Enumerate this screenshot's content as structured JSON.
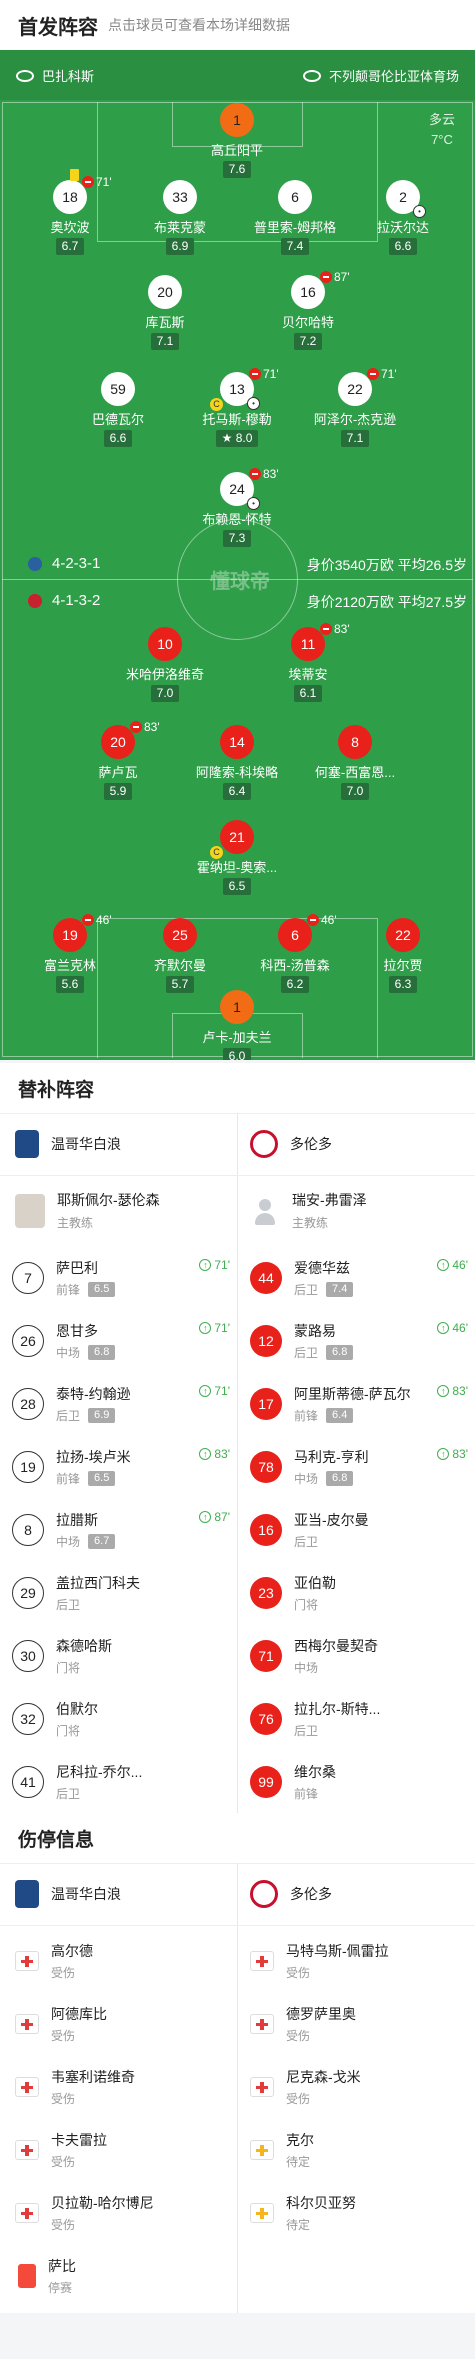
{
  "header": {
    "title": "首发阵容",
    "subtitle": "点击球员可查看本场详细数据"
  },
  "pitch": {
    "home_team": "巴扎科斯",
    "venue": "不列颠哥伦比亚体育场",
    "weather": {
      "condition": "多云",
      "temp": "7°C"
    },
    "watermark": "懂球帝",
    "home_formation": "4-2-3-1",
    "away_formation": "4-1-3-2",
    "home_value": "身价3540万欧 平均26.5岁",
    "away_value": "身价2120万欧 平均27.5岁",
    "colors": {
      "grass": "#2f9e49",
      "home_shirt": "#ffffff",
      "away_shirt": "#e8211a",
      "gk_shirt": "#f26c16"
    },
    "home_players": [
      {
        "num": "1",
        "name": "高丘阳平",
        "rating": "7.6"
      },
      {
        "num": "18",
        "name": "奥坎波",
        "rating": "6.7",
        "sub": "71'",
        "card": "yellow"
      },
      {
        "num": "33",
        "name": "布莱克蒙",
        "rating": "6.9"
      },
      {
        "num": "6",
        "name": "普里索-姆邦格",
        "rating": "7.4"
      },
      {
        "num": "2",
        "name": "拉沃尔达",
        "rating": "6.6"
      },
      {
        "num": "20",
        "name": "库瓦斯",
        "rating": "7.1"
      },
      {
        "num": "16",
        "name": "贝尔哈特",
        "rating": "7.2",
        "sub": "87'"
      },
      {
        "num": "59",
        "name": "巴德瓦尔",
        "rating": "6.6"
      },
      {
        "num": "13",
        "name": "托马斯-穆勒",
        "rating": "8.0",
        "sub": "71'",
        "star": true
      },
      {
        "num": "22",
        "name": "阿泽尔-杰克逊",
        "rating": "7.1",
        "sub": "71'"
      },
      {
        "num": "24",
        "name": "布赖恩-怀特",
        "rating": "7.3",
        "sub": "83'"
      }
    ],
    "away_players": [
      {
        "num": "10",
        "name": "米哈伊洛维奇",
        "rating": "7.0"
      },
      {
        "num": "11",
        "name": "埃蒂安",
        "rating": "6.1",
        "sub": "83'"
      },
      {
        "num": "20",
        "name": "萨卢瓦",
        "rating": "5.9",
        "sub": "83'"
      },
      {
        "num": "14",
        "name": "阿隆索-科埃略",
        "rating": "6.4"
      },
      {
        "num": "8",
        "name": "何塞-西富恩...",
        "rating": "7.0"
      },
      {
        "num": "21",
        "name": "霍纳坦-奥索...",
        "rating": "6.5"
      },
      {
        "num": "19",
        "name": "富兰克林",
        "rating": "5.6",
        "sub": "46'"
      },
      {
        "num": "25",
        "name": "齐默尔曼",
        "rating": "5.7"
      },
      {
        "num": "6",
        "name": "科西-汤普森",
        "rating": "6.2",
        "sub": "46'"
      },
      {
        "num": "22",
        "name": "拉尔贾",
        "rating": "6.3"
      },
      {
        "num": "1",
        "name": "卢卡-加夫兰",
        "rating": "6.0"
      }
    ]
  },
  "subs": {
    "title": "替补阵容",
    "home_team": "温哥华白浪",
    "away_team": "多伦多",
    "home_coach": {
      "name": "耶斯佩尔-瑟伦森",
      "role": "主教练"
    },
    "away_coach": {
      "name": "瑞安-弗雷泽",
      "role": "主教练"
    },
    "home": [
      {
        "num": "7",
        "name": "萨巴利",
        "pos": "前锋",
        "rating": "6.5",
        "in": "71'"
      },
      {
        "num": "26",
        "name": "恩甘多",
        "pos": "中场",
        "rating": "6.8",
        "in": "71'"
      },
      {
        "num": "28",
        "name": "泰特-约翰逊",
        "pos": "后卫",
        "rating": "6.9",
        "in": "71'"
      },
      {
        "num": "19",
        "name": "拉扬-埃卢米",
        "pos": "前锋",
        "rating": "6.5",
        "in": "83'"
      },
      {
        "num": "8",
        "name": "拉腊斯",
        "pos": "中场",
        "rating": "6.7",
        "in": "87'"
      },
      {
        "num": "29",
        "name": "盖拉西门科夫",
        "pos": "后卫"
      },
      {
        "num": "30",
        "name": "森德哈斯",
        "pos": "门将"
      },
      {
        "num": "32",
        "name": "伯默尔",
        "pos": "门将"
      },
      {
        "num": "41",
        "name": "尼科拉-乔尔...",
        "pos": "后卫"
      }
    ],
    "away": [
      {
        "num": "44",
        "name": "爱德华兹",
        "pos": "后卫",
        "rating": "7.4",
        "in": "46'"
      },
      {
        "num": "12",
        "name": "蒙路易",
        "pos": "后卫",
        "rating": "6.8",
        "in": "46'"
      },
      {
        "num": "17",
        "name": "阿里斯蒂德-萨瓦尔",
        "pos": "前锋",
        "rating": "6.4",
        "in": "83'"
      },
      {
        "num": "78",
        "name": "马利克-亨利",
        "pos": "中场",
        "rating": "6.8",
        "in": "83'"
      },
      {
        "num": "16",
        "name": "亚当-皮尔曼",
        "pos": "后卫"
      },
      {
        "num": "23",
        "name": "亚伯勒",
        "pos": "门将"
      },
      {
        "num": "71",
        "name": "西梅尔曼契奇",
        "pos": "中场"
      },
      {
        "num": "76",
        "name": "拉扎尔-斯特...",
        "pos": "后卫"
      },
      {
        "num": "99",
        "name": "维尔桑",
        "pos": "前锋"
      }
    ]
  },
  "injuries": {
    "title": "伤停信息",
    "home_team": "温哥华白浪",
    "away_team": "多伦多",
    "home": [
      {
        "name": "高尔德",
        "status": "受伤",
        "type": "injury"
      },
      {
        "name": "阿德库比",
        "status": "受伤",
        "type": "injury"
      },
      {
        "name": "韦塞利诺维奇",
        "status": "受伤",
        "type": "injury"
      },
      {
        "name": "卡夫雷拉",
        "status": "受伤",
        "type": "injury"
      },
      {
        "name": "贝拉勒-哈尔博尼",
        "status": "受伤",
        "type": "injury"
      },
      {
        "name": "萨比",
        "status": "停赛",
        "type": "card"
      }
    ],
    "away": [
      {
        "name": "马特乌斯-佩雷拉",
        "status": "受伤",
        "type": "injury"
      },
      {
        "name": "德罗萨里奥",
        "status": "受伤",
        "type": "injury"
      },
      {
        "name": "尼克森-戈米",
        "status": "受伤",
        "type": "injury"
      },
      {
        "name": "克尔",
        "status": "待定",
        "type": "pending"
      },
      {
        "name": "科尔贝亚努",
        "status": "待定",
        "type": "pending"
      }
    ]
  }
}
